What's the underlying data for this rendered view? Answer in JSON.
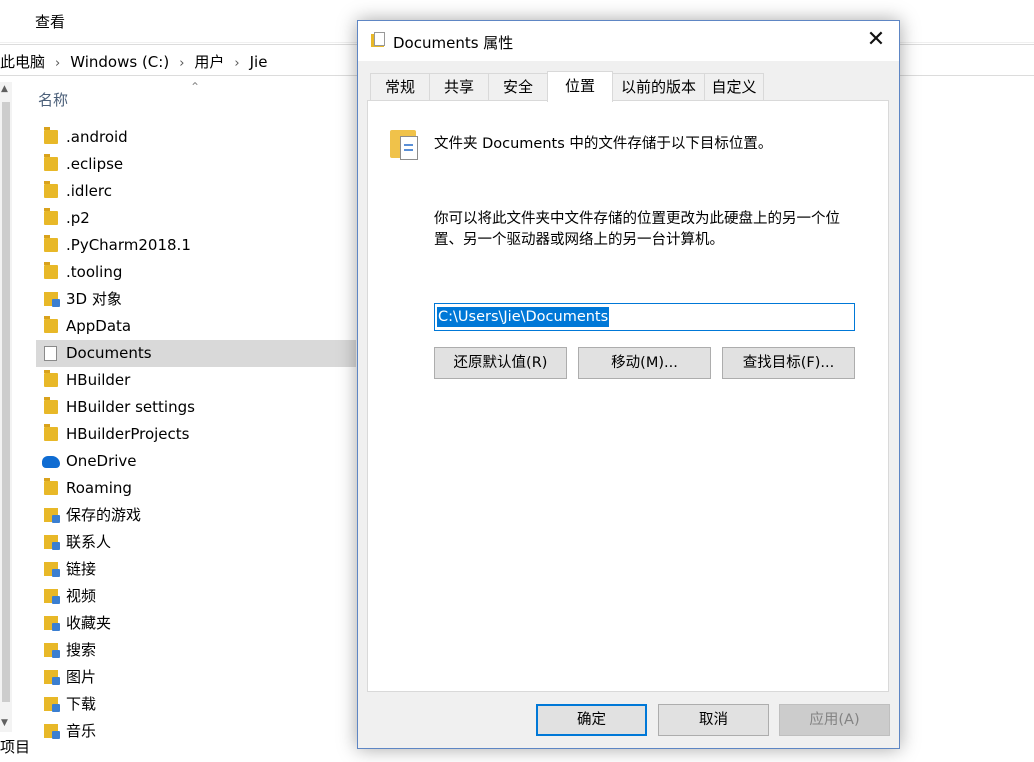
{
  "explorer": {
    "ribbon_tab": "查看",
    "breadcrumb": [
      "此电脑",
      "Windows (C:)",
      "用户",
      "Jie"
    ],
    "breadcrumb_sep": "›",
    "column_header": "名称",
    "files": [
      {
        "name": ".android",
        "icon": "folder-icon"
      },
      {
        "name": ".eclipse",
        "icon": "folder-icon"
      },
      {
        "name": ".idlerc",
        "icon": "folder-icon"
      },
      {
        "name": ".p2",
        "icon": "folder-icon"
      },
      {
        "name": ".PyCharm2018.1",
        "icon": "folder-icon"
      },
      {
        "name": ".tooling",
        "icon": "folder-icon"
      },
      {
        "name": "3D 对象",
        "icon": "3d-objects-icon"
      },
      {
        "name": "AppData",
        "icon": "folder-icon"
      },
      {
        "name": "Documents",
        "icon": "documents-icon",
        "selected": true
      },
      {
        "name": "HBuilder",
        "icon": "folder-icon"
      },
      {
        "name": "HBuilder settings",
        "icon": "folder-icon"
      },
      {
        "name": "HBuilderProjects",
        "icon": "folder-icon"
      },
      {
        "name": "OneDrive",
        "icon": "onedrive-cloud-icon"
      },
      {
        "name": "Roaming",
        "icon": "folder-icon"
      },
      {
        "name": "保存的游戏",
        "icon": "saved-games-icon"
      },
      {
        "name": "联系人",
        "icon": "contacts-icon"
      },
      {
        "name": "链接",
        "icon": "links-icon"
      },
      {
        "name": "视频",
        "icon": "videos-icon"
      },
      {
        "name": "收藏夹",
        "icon": "favorites-icon"
      },
      {
        "name": "搜索",
        "icon": "searches-icon"
      },
      {
        "name": "图片",
        "icon": "pictures-icon"
      },
      {
        "name": "下载",
        "icon": "downloads-icon"
      },
      {
        "name": "音乐",
        "icon": "music-icon"
      }
    ],
    "status_text": "项目"
  },
  "dialog": {
    "title": "Documents 属性",
    "close_glyph": "✕",
    "tabs": [
      {
        "label": "常规",
        "active": false
      },
      {
        "label": "共享",
        "active": false
      },
      {
        "label": "安全",
        "active": false
      },
      {
        "label": "位置",
        "active": true
      },
      {
        "label": "以前的版本",
        "active": false
      },
      {
        "label": "自定义",
        "active": false
      }
    ],
    "location_description": "文件夹 Documents 中的文件存储于以下目标位置。",
    "move_description": "你可以将此文件夹中文件存储的位置更改为此硬盘上的另一个位置、另一个驱动器或网络上的另一台计算机。",
    "path_value": "C:\\Users\\Jie\\Documents",
    "buttons": {
      "restore_default": "还原默认值(R)",
      "move": "移动(M)...",
      "find_target": "查找目标(F)..."
    },
    "footer": {
      "ok": "确定",
      "cancel": "取消",
      "apply": "应用(A)"
    }
  },
  "colors": {
    "accent": "#0078d7",
    "folder": "#e8b828",
    "selected_row": "#d9d9d9"
  }
}
